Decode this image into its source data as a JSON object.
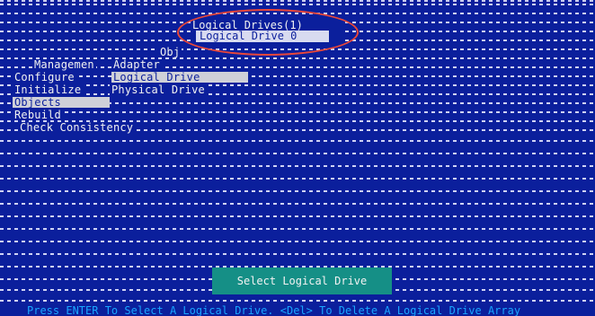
{
  "popup": {
    "title": "Logical Drives(1)",
    "item": "Logical Drive 0"
  },
  "header_obj": "Obj",
  "menu": {
    "management": "Managemen",
    "adapter": "Adapter",
    "configure": "Configure",
    "logical_drive": "Logical Drive",
    "initialize": "Initialize",
    "physical_drive": "Physical Drive",
    "objects": "Objects",
    "rebuild": "Rebuild",
    "check_consistency": "Check Consistency"
  },
  "status": "Select Logical Drive",
  "footer": "Press ENTER To Select A Logical Drive. <Del> To Delete A Logical Drive Array",
  "colors": {
    "background": "#0b1f9c",
    "highlight": "#cfd0d8",
    "status_box": "#158f86",
    "footer_text": "#1aa5ff",
    "annotation": "#e8473a"
  }
}
